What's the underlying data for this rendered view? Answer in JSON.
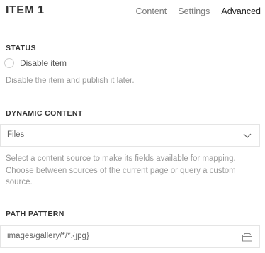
{
  "header": {
    "title": "ITEM 1",
    "tabs": [
      {
        "label": "Content",
        "active": false
      },
      {
        "label": "Settings",
        "active": false
      },
      {
        "label": "Advanced",
        "active": true
      }
    ]
  },
  "status": {
    "label": "STATUS",
    "option_label": "Disable item",
    "checked": false,
    "help": "Disable the item and publish it later."
  },
  "dynamic_content": {
    "label": "DYNAMIC CONTENT",
    "selected": "Files",
    "help": "Select a content source to make its fields available for mapping. Choose between sources of the current page or query a custom source."
  },
  "path_pattern": {
    "label": "PATH PATTERN",
    "value": "images/gallery/*/*.{jpg}"
  },
  "icons": {
    "select": "chevron-down-icon",
    "browse": "folder-icon"
  },
  "colors": {
    "active_tab": "#222222",
    "inactive_tab": "#7a7a7a",
    "help_text": "#999999",
    "border": "#e5e5e5"
  }
}
